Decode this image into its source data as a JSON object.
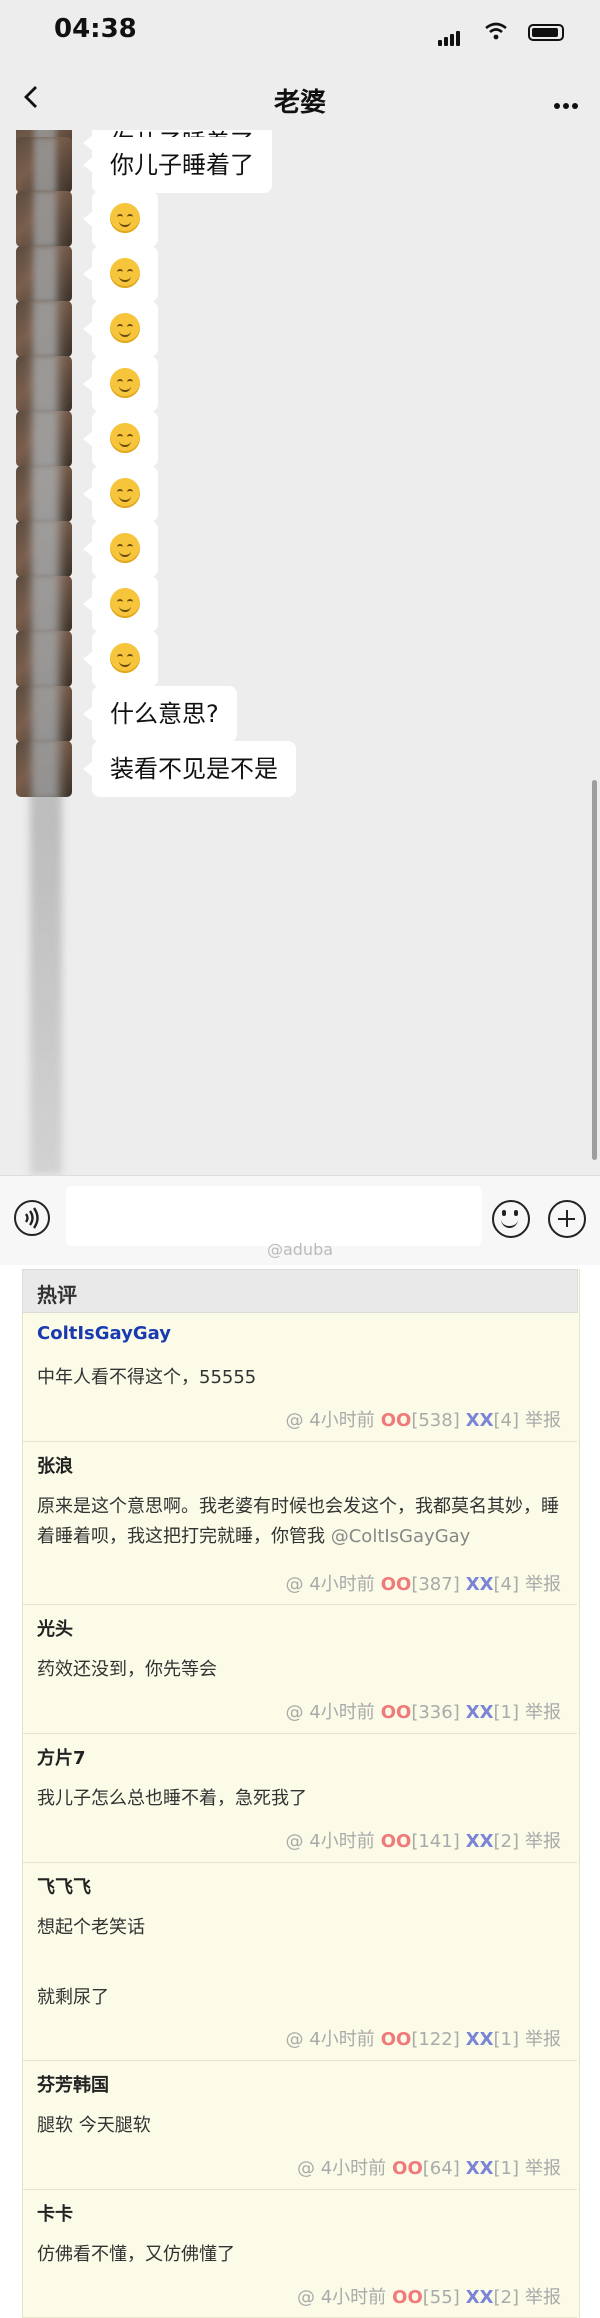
{
  "status": {
    "time": "04:38"
  },
  "nav": {
    "title": "老婆"
  },
  "messages": [
    {
      "type": "text",
      "text": "你儿子睡着了"
    },
    {
      "type": "text",
      "text": "你儿子睡着了"
    },
    {
      "type": "emoji",
      "icon": "smile-emoji"
    },
    {
      "type": "emoji",
      "icon": "smile-emoji"
    },
    {
      "type": "emoji",
      "icon": "smile-emoji"
    },
    {
      "type": "emoji",
      "icon": "smile-emoji"
    },
    {
      "type": "emoji",
      "icon": "smile-emoji"
    },
    {
      "type": "emoji",
      "icon": "smile-emoji"
    },
    {
      "type": "emoji",
      "icon": "smile-emoji"
    },
    {
      "type": "emoji",
      "icon": "smile-emoji"
    },
    {
      "type": "emoji",
      "icon": "smile-emoji"
    },
    {
      "type": "text",
      "text": "什么意思?"
    },
    {
      "type": "text",
      "text": "装看不见是不是"
    }
  ],
  "watermark": "@aduba",
  "comments_header": "热评",
  "comments": [
    {
      "name": "ColtIsGayGay",
      "text": "中年人看不得这个，55555",
      "time": "@ 4小时前",
      "oo": "OO",
      "oo_count": "[538]",
      "xx": "XX",
      "xx_count": "[4]",
      "report": "举报"
    },
    {
      "name": "张浪",
      "text": "原来是这个意思啊。我老婆有时候也会发这个，我都莫名其妙，睡着睡着呗，我这把打完就睡，你管我",
      "mention": "@ColtIsGayGay",
      "time": "@ 4小时前",
      "oo": "OO",
      "oo_count": "[387]",
      "xx": "XX",
      "xx_count": "[4]",
      "report": "举报"
    },
    {
      "name": "光头",
      "text": "药效还没到，你先等会",
      "time": "@ 4小时前",
      "oo": "OO",
      "oo_count": "[336]",
      "xx": "XX",
      "xx_count": "[1]",
      "report": "举报"
    },
    {
      "name": "方片7",
      "text": "我儿子怎么总也睡不着，急死我了",
      "time": "@ 4小时前",
      "oo": "OO",
      "oo_count": "[141]",
      "xx": "XX",
      "xx_count": "[2]",
      "report": "举报"
    },
    {
      "name": "飞飞飞",
      "text": "想起个老笑话",
      "text2": "就剩尿了",
      "time": "@ 4小时前",
      "oo": "OO",
      "oo_count": "[122]",
      "xx": "XX",
      "xx_count": "[1]",
      "report": "举报"
    },
    {
      "name": "芬芳韩国",
      "text": "腿软 今天腿软",
      "time": "@ 4小时前",
      "oo": "OO",
      "oo_count": "[64]",
      "xx": "XX",
      "xx_count": "[1]",
      "report": "举报"
    },
    {
      "name": "卡卡",
      "text": "仿佛看不懂，又仿佛懂了",
      "time": "@ 4小时前",
      "oo": "OO",
      "oo_count": "[55]",
      "xx": "XX",
      "xx_count": "[2]",
      "report": "举报"
    }
  ]
}
